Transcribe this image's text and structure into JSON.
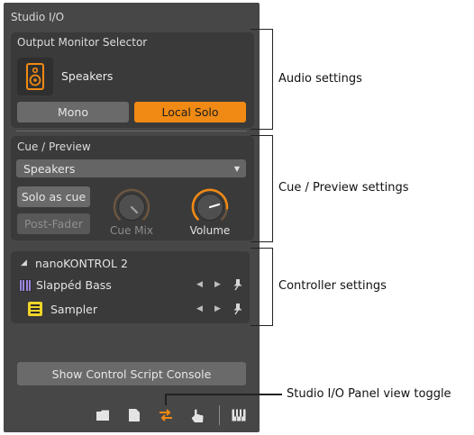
{
  "panel": {
    "title": "Studio I/O"
  },
  "output_monitor": {
    "heading": "Output Monitor Selector",
    "device_label": "Speakers",
    "mono_label": "Mono",
    "local_solo_label": "Local Solo"
  },
  "cue_preview": {
    "heading": "Cue / Preview",
    "dropdown_value": "Speakers",
    "solo_as_cue_label": "Solo as cue",
    "post_fader_label": "Post-Fader",
    "cue_mix_label": "Cue Mix",
    "volume_label": "Volume"
  },
  "controller": {
    "name": "nanoKONTROL 2",
    "tracks": [
      {
        "label": "Slappéd Bass"
      },
      {
        "label": "Sampler"
      }
    ]
  },
  "console_button_label": "Show Control Script Console",
  "annotations": {
    "audio": "Audio settings",
    "cue": "Cue / Preview settings",
    "controller": "Controller settings",
    "toggle": "Studio I/O Panel view toggle"
  },
  "colors": {
    "panel_bg": "#474747",
    "card_bg": "#3a3a3a",
    "accent_orange": "#f08a14",
    "track_purple": "#9b86e0"
  }
}
